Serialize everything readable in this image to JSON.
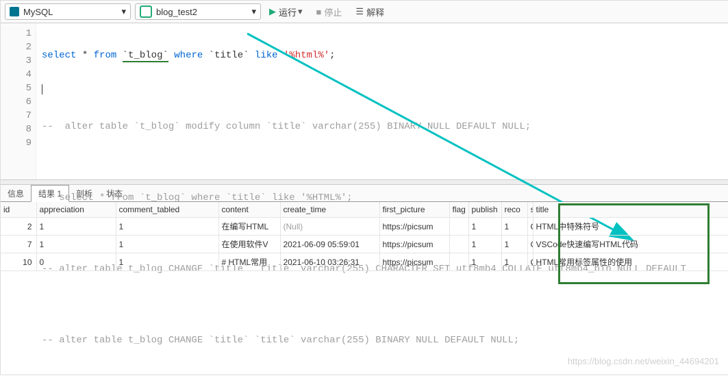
{
  "toolbar": {
    "engine": "MySQL",
    "database": "blog_test2",
    "run": "运行",
    "stop": "停止",
    "explain": "解释"
  },
  "code": {
    "l1": {
      "kw1": "select",
      "star": "*",
      "kw2": "from",
      "tbl": "`t_blog`",
      "kw3": "where",
      "colFull": "`title`",
      "kw4": "like",
      "str": "'%html%'",
      "end": ";"
    },
    "l3": "--  alter table `t_blog` modify column `title` varchar(255) BINARY NULL DEFAULT NULL;",
    "l5": "-- select * from `t_blog` where `title` like '%HTML%';",
    "l7": "-- alter table t_blog CHANGE `title` `title` varchar(255) CHARACTER SET utf8mb4 COLLATE utf8mb4_bin NULL DEFAULT",
    "l9": "-- alter table t_blog CHANGE `title` `title` varchar(255) BINARY NULL DEFAULT NULL;"
  },
  "lineNumbers": [
    "1",
    "2",
    "3",
    "4",
    "5",
    "6",
    "7",
    "8",
    "9"
  ],
  "tabs": {
    "info": "信息",
    "result": "结果 1",
    "profile": "剖析",
    "status": "状态"
  },
  "columns": {
    "id": "id",
    "appreciation": "appreciation",
    "comment_tabled": "comment_tabled",
    "content": "content",
    "create_time": "create_time",
    "first_picture": "first_picture",
    "flag": "flag",
    "publish": "publish",
    "reco": "reco",
    "shiptit": "s",
    "title": "title"
  },
  "rows": [
    {
      "id": "2",
      "appreciation": "1",
      "comment_tabled": "1",
      "content": "在编写HTML",
      "create_time": "(Null)",
      "first_picture": "https://picsum",
      "flag": "",
      "publish": "1",
      "reco": "1",
      "ship": "C",
      "title": "HTML中特殊符号"
    },
    {
      "id": "7",
      "appreciation": "1",
      "comment_tabled": "1",
      "content": "在使用软件V",
      "create_time": "2021-06-09 05:59:01",
      "first_picture": "https://picsum",
      "flag": "",
      "publish": "1",
      "reco": "1",
      "ship": "C",
      "title": "VSCode快速编写HTML代码"
    },
    {
      "id": "10",
      "appreciation": "0",
      "comment_tabled": "1",
      "content": "# HTML常用",
      "create_time": "2021-06-10 03:26:31",
      "first_picture": "https://picsum",
      "flag": "",
      "publish": "1",
      "reco": "1",
      "ship": "C",
      "title": "HTML常用标签属性的使用"
    }
  ],
  "watermark": "https://blog.csdn.net/weixin_44694201"
}
